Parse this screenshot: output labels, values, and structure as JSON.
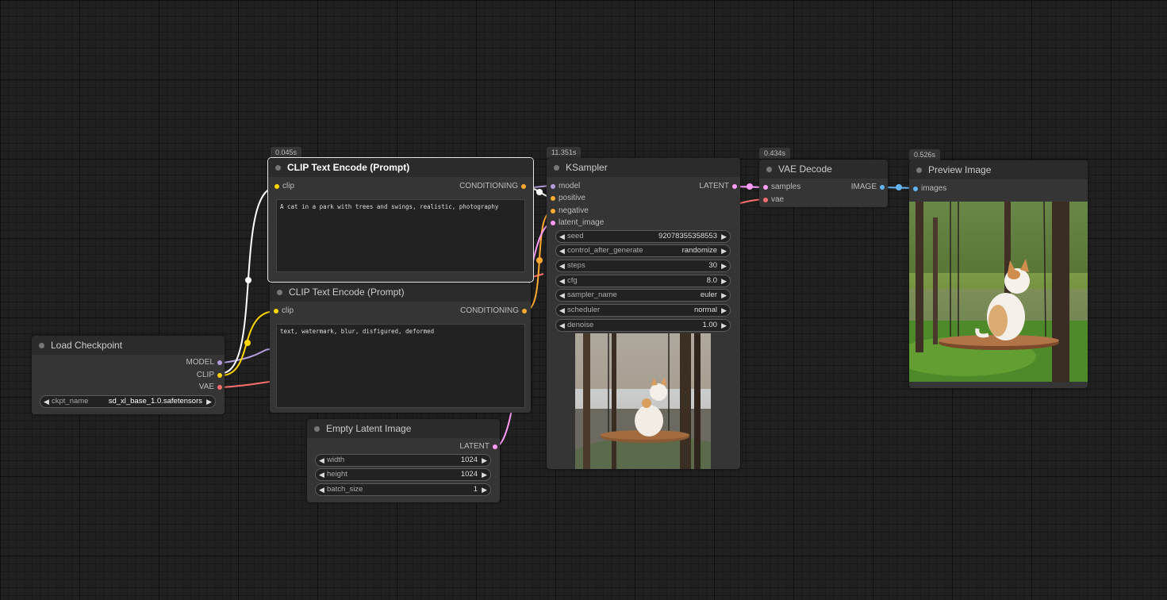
{
  "colors": {
    "clip": "#ffd500",
    "model": "#b39ddb",
    "vae": "#ff6e6e",
    "conditioning": "#ffa931",
    "latent": "#ff9cf9",
    "image": "#64b5f6",
    "link_white": "#ffffff"
  },
  "nodes": {
    "clip_pos": {
      "badge": "0.045s",
      "title": "CLIP Text Encode (Prompt)",
      "input": "clip",
      "output": "CONDITIONING",
      "text": "A cat in a park with trees and swings, realistic, photography"
    },
    "clip_neg": {
      "title": "CLIP Text Encode (Prompt)",
      "input": "clip",
      "output": "CONDITIONING",
      "text": "text, watermark, blur, disfigured, deformed"
    },
    "load_checkpoint": {
      "title": "Load Checkpoint",
      "outputs": [
        "MODEL",
        "CLIP",
        "VAE"
      ],
      "ckpt_name_label": "ckpt_name",
      "ckpt_name_value": "sd_xl_base_1.0.safetensors"
    },
    "empty_latent": {
      "title": "Empty Latent Image",
      "output": "LATENT",
      "widgets": [
        {
          "name": "width",
          "value": "1024"
        },
        {
          "name": "height",
          "value": "1024"
        },
        {
          "name": "batch_size",
          "value": "1"
        }
      ]
    },
    "ksampler": {
      "badge": "11.351s",
      "title": "KSampler",
      "inputs": [
        "model",
        "positive",
        "negative",
        "latent_image"
      ],
      "output": "LATENT",
      "widgets": [
        {
          "name": "seed",
          "value": "92078355358553"
        },
        {
          "name": "control_after_generate",
          "value": "randomize"
        },
        {
          "name": "steps",
          "value": "30"
        },
        {
          "name": "cfg",
          "value": "8.0"
        },
        {
          "name": "sampler_name",
          "value": "euler"
        },
        {
          "name": "scheduler",
          "value": "normal"
        },
        {
          "name": "denoise",
          "value": "1.00"
        }
      ]
    },
    "vae_decode": {
      "badge": "0.434s",
      "title": "VAE Decode",
      "inputs": [
        "samples",
        "vae"
      ],
      "output": "IMAGE"
    },
    "preview": {
      "badge": "0.526s",
      "title": "Preview Image",
      "input": "images"
    }
  }
}
